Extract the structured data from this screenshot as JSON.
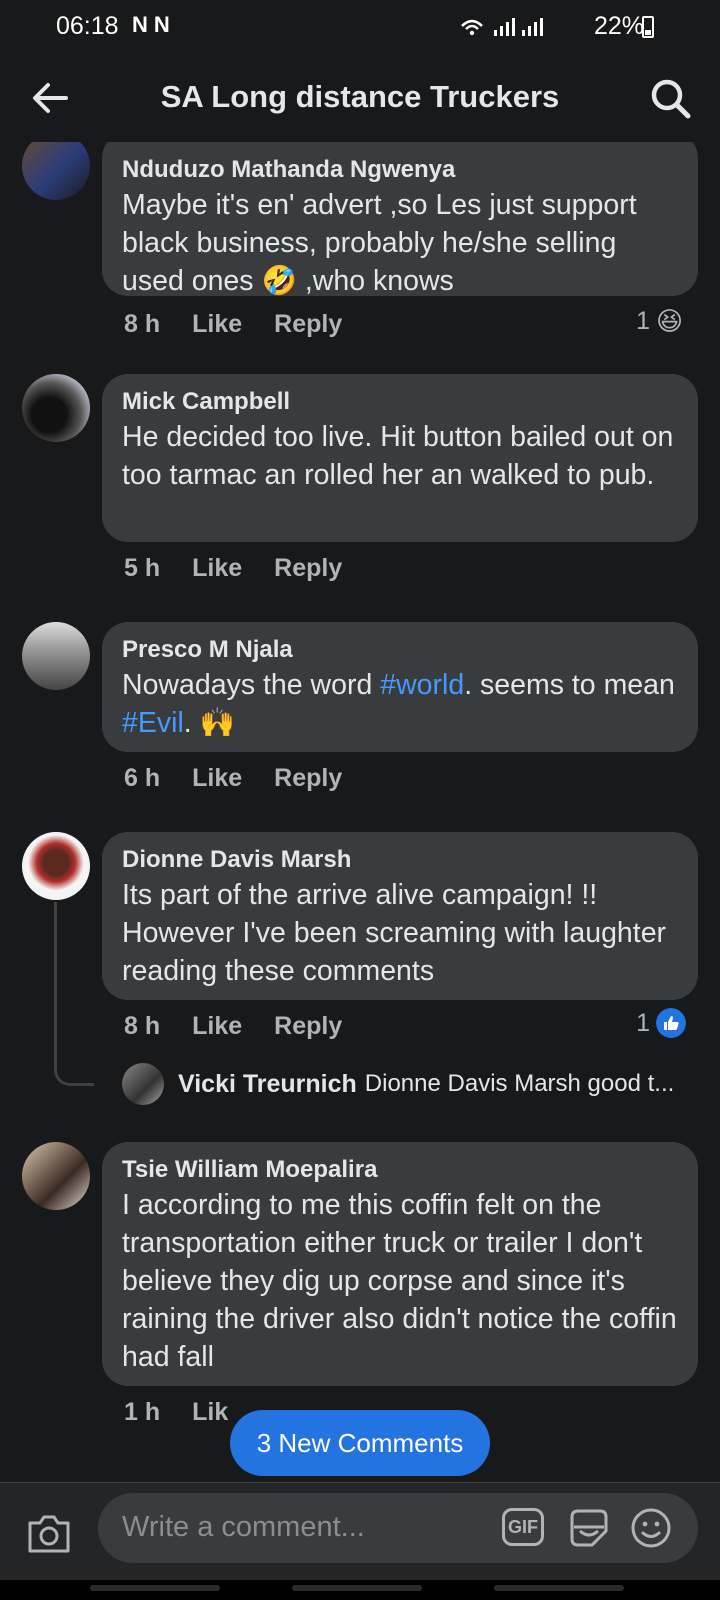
{
  "status_bar": {
    "time": "06:18",
    "notif_icons": "NN",
    "battery": "22%"
  },
  "header": {
    "title": "SA Long distance Truckers"
  },
  "comments": [
    {
      "name": "Nduduzo Mathanda Ngwenya",
      "text1": "Maybe it's en' advert ,so Les just support black business, probably he/she selling used ones ",
      "emoji": "🤣",
      "text2": " ,who knows",
      "time": "8 h",
      "like": "Like",
      "reply": "Reply",
      "reaction_count": "1",
      "reaction_emoji": "😆"
    },
    {
      "name": "Mick Campbell",
      "text": "He decided too live. Hit button bailed out on too tarmac an rolled her an walked to pub.",
      "time": "5 h",
      "like": "Like",
      "reply": "Reply"
    },
    {
      "name": "Presco M Njala",
      "text_pre": "Nowadays the word ",
      "tag1": "#world",
      "text_mid": ". seems to mean ",
      "tag2": "#Evil",
      "text_post": ". ",
      "emoji": "🙌",
      "time": "6 h",
      "like": "Like",
      "reply": "Reply"
    },
    {
      "name": "Dionne Davis Marsh",
      "text": "Its part of the arrive alive campaign! !! However I've been screaming with laughter reading these comments",
      "time": "8 h",
      "like": "Like",
      "reply": "Reply",
      "reaction_count": "1",
      "reaction_emoji": "👍"
    },
    {
      "name": "Tsie William Moepalira",
      "text": "I according to me this coffin felt on the transportation either truck or trailer I don't believe they dig up corpse and since it's raining the driver also didn't notice the coffin had fall",
      "time": "1 h",
      "like": "Lik"
    }
  ],
  "reply_preview": {
    "name": "Vicki Treurnich",
    "text": "Dionne Davis Marsh good t..."
  },
  "new_comments": {
    "label": "3 New Comments"
  },
  "composer": {
    "placeholder": "Write a comment...",
    "gif_label": "GIF"
  },
  "colors": {
    "background": "#18191a",
    "bubble": "#3a3b3c",
    "accent": "#2374e1",
    "hashtag": "#4599ff"
  }
}
